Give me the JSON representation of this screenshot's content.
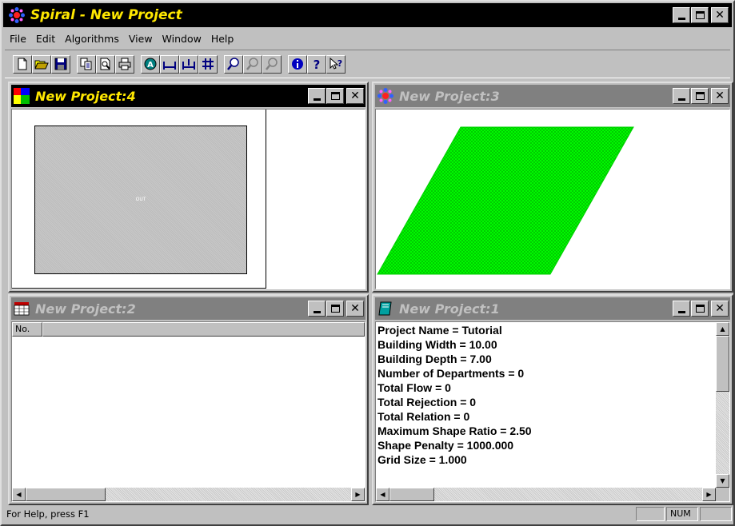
{
  "app": {
    "title": "Spiral - New Project",
    "icon": "spiral-app-icon"
  },
  "menu": {
    "items": [
      {
        "label": "File"
      },
      {
        "label": "Edit"
      },
      {
        "label": "Algorithms"
      },
      {
        "label": "View"
      },
      {
        "label": "Window"
      },
      {
        "label": "Help"
      }
    ]
  },
  "toolbar": {
    "groups": [
      [
        "new-file-icon",
        "open-folder-icon",
        "save-disk-icon"
      ],
      [
        "copy-icon",
        "print-preview-icon",
        "printer-icon"
      ],
      [
        "algorithm-a-icon",
        "width-icon",
        "depth-icon",
        "grid-icon"
      ],
      [
        "zoom-icon",
        "zoom-in-icon",
        "zoom-out-icon"
      ],
      [
        "info-icon",
        "help-icon",
        "context-help-icon"
      ]
    ]
  },
  "windows": {
    "w4": {
      "title": "New Project:4",
      "icon": "layout-colors-icon",
      "floor_label": "OUT",
      "active": true
    },
    "w3": {
      "title": "New Project:3",
      "icon": "molecule-icon",
      "active": false,
      "fill_color": "#00ff00"
    },
    "w2": {
      "title": "New Project:2",
      "icon": "table-icon",
      "column_header": "No.",
      "active": false
    },
    "w1": {
      "title": "New Project:1",
      "icon": "notebook-icon",
      "active": false,
      "lines": [
        "Project Name = Tutorial",
        "Building Width = 10.00",
        "Building Depth = 7.00",
        "Number of Departments = 0",
        "Total Flow = 0",
        "Total Rejection = 0",
        "Total Relation = 0",
        "Maximum Shape Ratio = 2.50",
        "Shape Penalty = 1000.000",
        "Grid Size = 1.000"
      ]
    }
  },
  "status": {
    "text": "For Help, press F1",
    "num": "NUM"
  },
  "colors": {
    "title_active_bg": "#000000",
    "title_text": "#ffe800",
    "title_inactive_bg": "#808080",
    "face": "#c0c0c0",
    "green_shape": "#00ff00"
  }
}
